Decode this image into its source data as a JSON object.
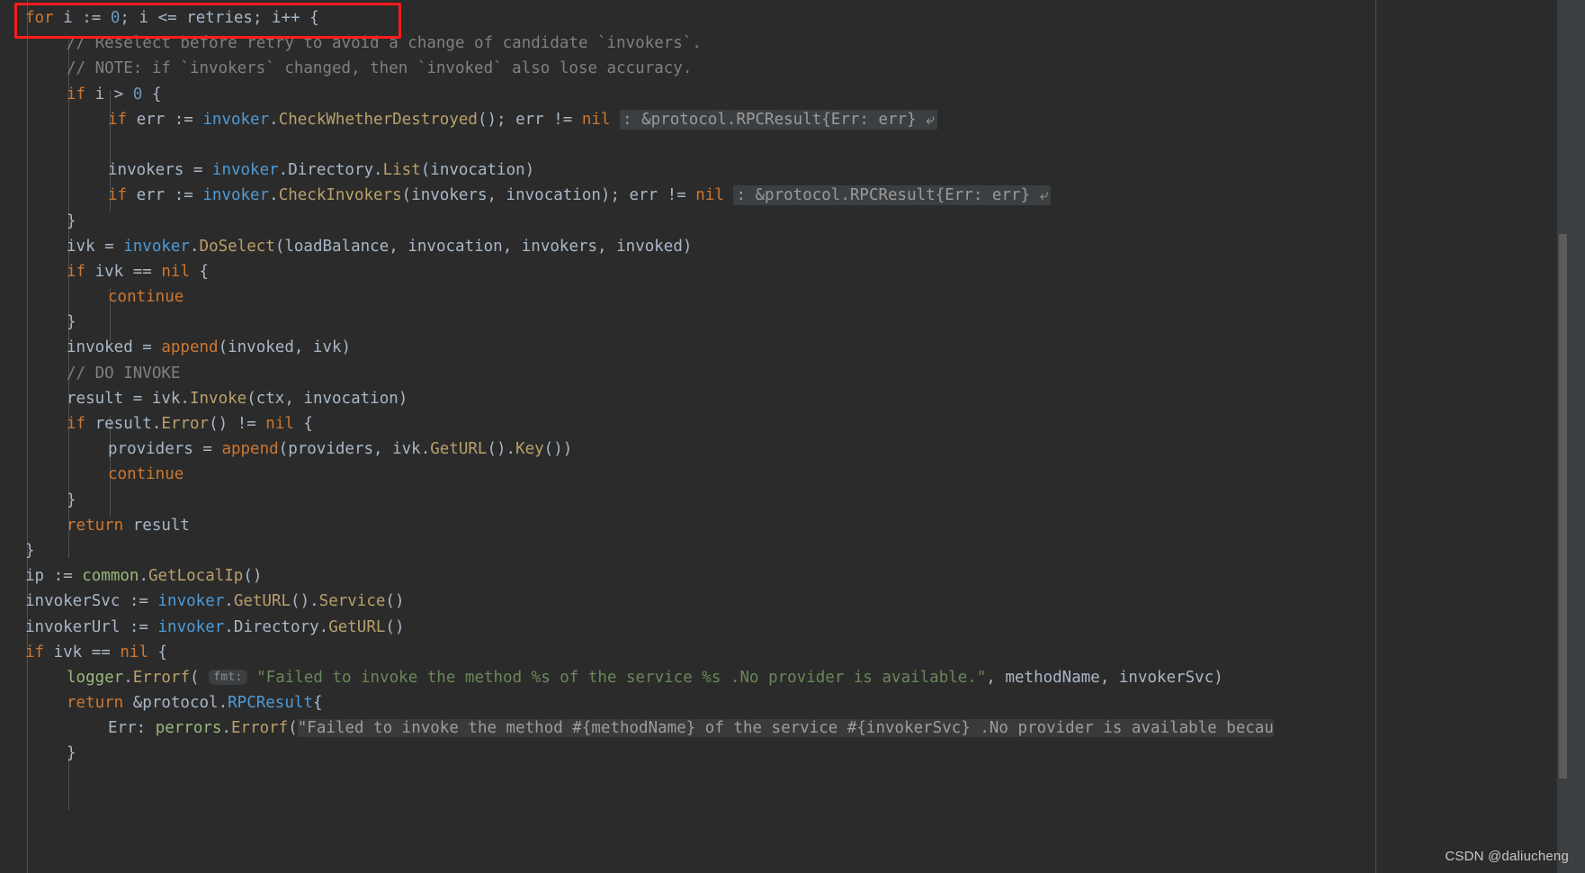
{
  "editor": {
    "language": "go",
    "theme_name": "darcula",
    "colors": {
      "background": "#2b2b2b",
      "panel": "#3c3f41",
      "default_text": "#a9b7c6",
      "keyword": "#cc7832",
      "string": "#6a8759",
      "comment": "#808080",
      "number": "#6897bb",
      "function": "#b9a06a",
      "package": "#9ab87b",
      "receiver": "#4e9ad6",
      "inlay_background": "#3c3f41",
      "annotation_red": "#fd1c1c",
      "scrollbar_thumb": "#595b5d"
    },
    "watermark": "CSDN @daliucheng",
    "annotation": {
      "type": "red-rectangle",
      "target_text": "for i := 0; i <= retries; i++ {"
    }
  },
  "code": {
    "lines": [
      {
        "indent": 0,
        "tokens": [
          {
            "t": "for",
            "c": "kw"
          },
          {
            "t": " ",
            "c": "punc"
          },
          {
            "t": "i",
            "c": "ident"
          },
          {
            "t": " := ",
            "c": "punc"
          },
          {
            "t": "0",
            "c": "num"
          },
          {
            "t": "; ",
            "c": "punc"
          },
          {
            "t": "i",
            "c": "ident"
          },
          {
            "t": " <= ",
            "c": "punc"
          },
          {
            "t": "retries",
            "c": "ident"
          },
          {
            "t": "; ",
            "c": "punc"
          },
          {
            "t": "i++ {",
            "c": "punc"
          }
        ]
      },
      {
        "indent": 1,
        "tokens": [
          {
            "t": "// Reselect before retry to avoid a change of candidate `invokers`.",
            "c": "cmt"
          }
        ]
      },
      {
        "indent": 1,
        "tokens": [
          {
            "t": "// NOTE: if `invokers` changed, then `invoked` also lose accuracy.",
            "c": "cmt"
          }
        ]
      },
      {
        "indent": 1,
        "tokens": [
          {
            "t": "if",
            "c": "kw"
          },
          {
            "t": " i > ",
            "c": "punc"
          },
          {
            "t": "0",
            "c": "num"
          },
          {
            "t": " {",
            "c": "punc"
          }
        ]
      },
      {
        "indent": 2,
        "tokens": [
          {
            "t": "if",
            "c": "kw"
          },
          {
            "t": " err := ",
            "c": "punc"
          },
          {
            "t": "invoker",
            "c": "recv"
          },
          {
            "t": ".",
            "c": "punc"
          },
          {
            "t": "CheckWhetherDestroyed",
            "c": "fn"
          },
          {
            "t": "(); err != ",
            "c": "punc"
          },
          {
            "t": "nil",
            "c": "kw"
          },
          {
            "t": " ",
            "c": "punc"
          },
          {
            "t": ": &protocol.RPCResult{Err: err} ⤶",
            "c": "inlay-fold"
          }
        ]
      },
      {
        "indent": 0,
        "tokens": []
      },
      {
        "indent": 2,
        "tokens": [
          {
            "t": "invokers = ",
            "c": "punc"
          },
          {
            "t": "invoker",
            "c": "recv"
          },
          {
            "t": ".",
            "c": "punc"
          },
          {
            "t": "Directory",
            "c": "punc"
          },
          {
            "t": ".",
            "c": "punc"
          },
          {
            "t": "List",
            "c": "fn"
          },
          {
            "t": "(invocation)",
            "c": "punc"
          }
        ]
      },
      {
        "indent": 2,
        "tokens": [
          {
            "t": "if",
            "c": "kw"
          },
          {
            "t": " err := ",
            "c": "punc"
          },
          {
            "t": "invoker",
            "c": "recv"
          },
          {
            "t": ".",
            "c": "punc"
          },
          {
            "t": "CheckInvokers",
            "c": "fn"
          },
          {
            "t": "(invokers, invocation); err != ",
            "c": "punc"
          },
          {
            "t": "nil",
            "c": "kw"
          },
          {
            "t": " ",
            "c": "punc"
          },
          {
            "t": ": &protocol.RPCResult{Err: err} ⤶",
            "c": "inlay-fold"
          }
        ]
      },
      {
        "indent": 1,
        "tokens": [
          {
            "t": "}",
            "c": "punc"
          }
        ]
      },
      {
        "indent": 1,
        "tokens": [
          {
            "t": "ivk = ",
            "c": "punc"
          },
          {
            "t": "invoker",
            "c": "recv"
          },
          {
            "t": ".",
            "c": "punc"
          },
          {
            "t": "DoSelect",
            "c": "fn"
          },
          {
            "t": "(loadBalance, invocation, invokers, invoked)",
            "c": "punc"
          }
        ]
      },
      {
        "indent": 1,
        "tokens": [
          {
            "t": "if",
            "c": "kw"
          },
          {
            "t": " ivk == ",
            "c": "punc"
          },
          {
            "t": "nil",
            "c": "kw"
          },
          {
            "t": " {",
            "c": "punc"
          }
        ]
      },
      {
        "indent": 2,
        "tokens": [
          {
            "t": "continue",
            "c": "kw"
          }
        ]
      },
      {
        "indent": 1,
        "tokens": [
          {
            "t": "}",
            "c": "punc"
          }
        ]
      },
      {
        "indent": 1,
        "tokens": [
          {
            "t": "invoked = ",
            "c": "punc"
          },
          {
            "t": "append",
            "c": "kw"
          },
          {
            "t": "(invoked, ivk)",
            "c": "punc"
          }
        ]
      },
      {
        "indent": 1,
        "tokens": [
          {
            "t": "// DO INVOKE",
            "c": "cmt"
          }
        ]
      },
      {
        "indent": 1,
        "tokens": [
          {
            "t": "result = ivk.",
            "c": "punc"
          },
          {
            "t": "Invoke",
            "c": "fn"
          },
          {
            "t": "(ctx, invocation)",
            "c": "punc"
          }
        ]
      },
      {
        "indent": 1,
        "tokens": [
          {
            "t": "if",
            "c": "kw"
          },
          {
            "t": " result.",
            "c": "punc"
          },
          {
            "t": "Error",
            "c": "fn"
          },
          {
            "t": "() != ",
            "c": "punc"
          },
          {
            "t": "nil",
            "c": "kw"
          },
          {
            "t": " {",
            "c": "punc"
          }
        ]
      },
      {
        "indent": 2,
        "tokens": [
          {
            "t": "providers = ",
            "c": "punc"
          },
          {
            "t": "append",
            "c": "kw"
          },
          {
            "t": "(providers, ivk.",
            "c": "punc"
          },
          {
            "t": "GetURL",
            "c": "fn"
          },
          {
            "t": "().",
            "c": "punc"
          },
          {
            "t": "Key",
            "c": "fn"
          },
          {
            "t": "())",
            "c": "punc"
          }
        ]
      },
      {
        "indent": 2,
        "tokens": [
          {
            "t": "continue",
            "c": "kw"
          }
        ]
      },
      {
        "indent": 1,
        "tokens": [
          {
            "t": "}",
            "c": "punc"
          }
        ]
      },
      {
        "indent": 1,
        "tokens": [
          {
            "t": "return",
            "c": "kw"
          },
          {
            "t": " result",
            "c": "punc"
          }
        ]
      },
      {
        "indent": 0,
        "tokens": [
          {
            "t": "}",
            "c": "punc"
          }
        ]
      },
      {
        "indent": 0,
        "tokens": [
          {
            "t": "ip := ",
            "c": "punc"
          },
          {
            "t": "common",
            "c": "pkg"
          },
          {
            "t": ".",
            "c": "punc"
          },
          {
            "t": "GetLocalIp",
            "c": "fn"
          },
          {
            "t": "()",
            "c": "punc"
          }
        ]
      },
      {
        "indent": 0,
        "tokens": [
          {
            "t": "invokerSvc := ",
            "c": "punc"
          },
          {
            "t": "invoker",
            "c": "recv"
          },
          {
            "t": ".",
            "c": "punc"
          },
          {
            "t": "GetURL",
            "c": "fn"
          },
          {
            "t": "().",
            "c": "punc"
          },
          {
            "t": "Service",
            "c": "fn"
          },
          {
            "t": "()",
            "c": "punc"
          }
        ]
      },
      {
        "indent": 0,
        "tokens": [
          {
            "t": "invokerUrl := ",
            "c": "punc"
          },
          {
            "t": "invoker",
            "c": "recv"
          },
          {
            "t": ".",
            "c": "punc"
          },
          {
            "t": "Directory",
            "c": "punc"
          },
          {
            "t": ".",
            "c": "punc"
          },
          {
            "t": "GetURL",
            "c": "fn"
          },
          {
            "t": "()",
            "c": "punc"
          }
        ]
      },
      {
        "indent": 0,
        "tokens": [
          {
            "t": "if",
            "c": "kw"
          },
          {
            "t": " ivk == ",
            "c": "punc"
          },
          {
            "t": "nil",
            "c": "kw"
          },
          {
            "t": " {",
            "c": "punc"
          }
        ]
      },
      {
        "indent": 1,
        "tokens": [
          {
            "t": "logger",
            "c": "pkg"
          },
          {
            "t": ".",
            "c": "punc"
          },
          {
            "t": "Errorf",
            "c": "fn"
          },
          {
            "t": "( ",
            "c": "punc"
          },
          {
            "t": "fmt:",
            "c": "inlay-param"
          },
          {
            "t": " ",
            "c": "punc"
          },
          {
            "t": "\"Failed to invoke the method %s of the service %s .No provider is available.\"",
            "c": "str"
          },
          {
            "t": ", methodName, invokerSvc)",
            "c": "punc"
          }
        ]
      },
      {
        "indent": 1,
        "tokens": [
          {
            "t": "return",
            "c": "kw"
          },
          {
            "t": " &protocol.",
            "c": "punc"
          },
          {
            "t": "RPCResult",
            "c": "recv"
          },
          {
            "t": "{",
            "c": "punc"
          }
        ]
      },
      {
        "indent": 2,
        "tokens": [
          {
            "t": "Err: ",
            "c": "punc"
          },
          {
            "t": "perrors",
            "c": "pkg"
          },
          {
            "t": ".",
            "c": "punc"
          },
          {
            "t": "Errorf",
            "c": "fn"
          },
          {
            "t": "(",
            "c": "punc"
          },
          {
            "t": "\"Failed to invoke the method #{methodName} of the service #{invokerSvc} .No provider is available becau",
            "c": "search-hl"
          }
        ]
      },
      {
        "indent": 1,
        "tokens": [
          {
            "t": "}",
            "c": "punc"
          }
        ]
      }
    ]
  }
}
